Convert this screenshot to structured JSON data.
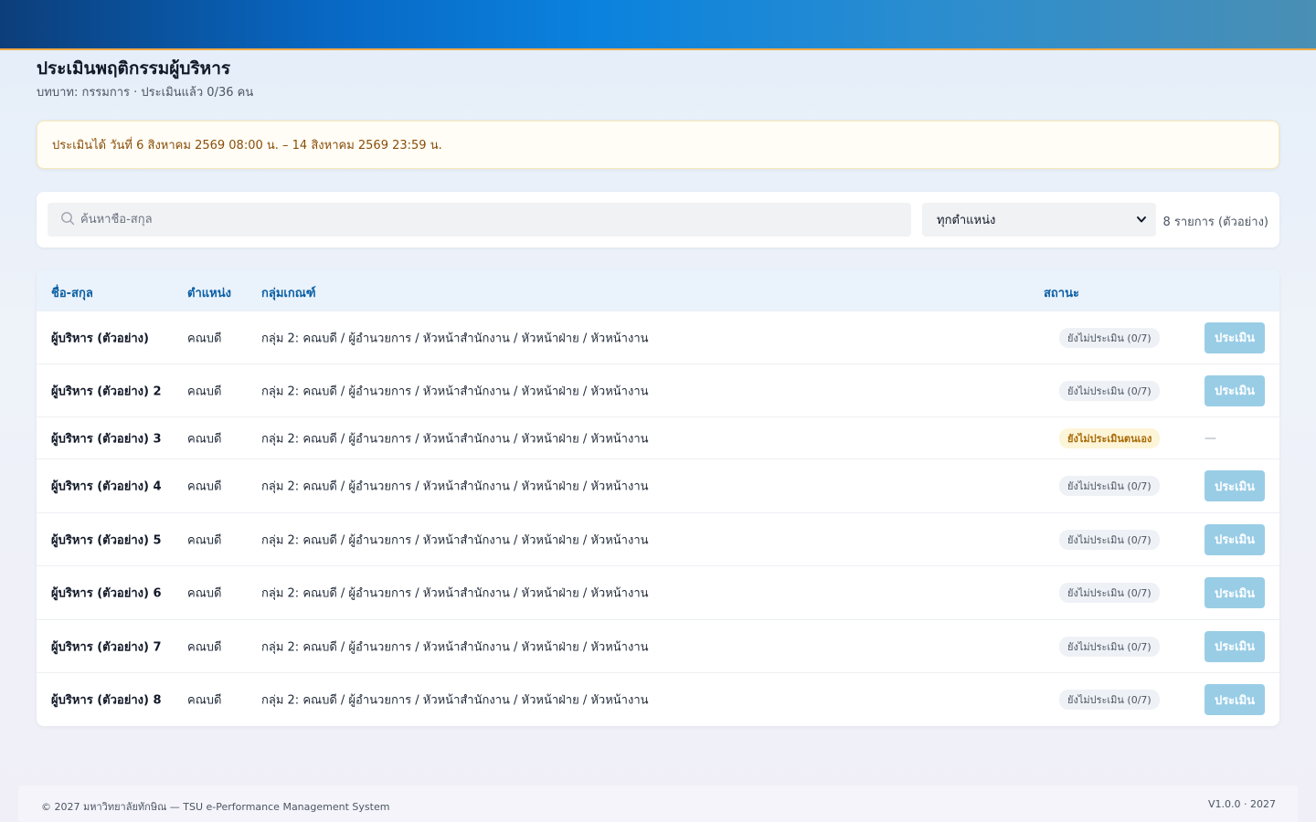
{
  "header": {
    "title": "ประเมินพฤติกรรมผู้บริหาร",
    "subtitle": "บทบาท: กรรมการ · ประเมินแล้ว 0/36 คน"
  },
  "notice": "ประเมินได้ วันที่ 6 สิงหาคม 2569 08:00 น. – 14 สิงหาคม 2569 23:59 น.",
  "filters": {
    "search_placeholder": "ค้นหาชื่อ-สกุล",
    "position_selected": "ทุกตำแหน่ง",
    "count_label": "8 รายการ (ตัวอย่าง)"
  },
  "table": {
    "headers": {
      "name": "ชื่อ-สกุล",
      "position": "ตำแหน่ง",
      "group": "กลุ่มเกณฑ์",
      "status": "สถานะ"
    },
    "action_label": "ประเมิน",
    "rows": [
      {
        "name": "ผู้บริหาร (ตัวอย่าง)",
        "position": "คณบดี",
        "group": "กลุ่ม 2: คณบดี / ผู้อำนวยการ / หัวหน้าสำนักงาน / หัวหน้าฝ่าย / หัวหน้างาน",
        "status": "ยังไม่ประเมิน (0/7)",
        "action": "ประเมิน"
      },
      {
        "name": "ผู้บริหาร (ตัวอย่าง) 2",
        "position": "คณบดี",
        "group": "กลุ่ม 2: คณบดี / ผู้อำนวยการ / หัวหน้าสำนักงาน / หัวหน้าฝ่าย / หัวหน้างาน",
        "status": "ยังไม่ประเมิน (0/7)",
        "action": "ประเมิน"
      },
      {
        "name": "ผู้บริหาร (ตัวอย่าง) 3",
        "position": "คณบดี",
        "group": "กลุ่ม 2: คณบดี / ผู้อำนวยการ / หัวหน้าสำนักงาน / หัวหน้าฝ่าย / หัวหน้างาน",
        "status": "ยังไม่ประเมินตนเอง",
        "action": "—"
      },
      {
        "name": "ผู้บริหาร (ตัวอย่าง) 4",
        "position": "คณบดี",
        "group": "กลุ่ม 2: คณบดี / ผู้อำนวยการ / หัวหน้าสำนักงาน / หัวหน้าฝ่าย / หัวหน้างาน",
        "status": "ยังไม่ประเมิน (0/7)",
        "action": "ประเมิน"
      },
      {
        "name": "ผู้บริหาร (ตัวอย่าง) 5",
        "position": "คณบดี",
        "group": "กลุ่ม 2: คณบดี / ผู้อำนวยการ / หัวหน้าสำนักงาน / หัวหน้าฝ่าย / หัวหน้างาน",
        "status": "ยังไม่ประเมิน (0/7)",
        "action": "ประเมิน"
      },
      {
        "name": "ผู้บริหาร (ตัวอย่าง) 6",
        "position": "คณบดี",
        "group": "กลุ่ม 2: คณบดี / ผู้อำนวยการ / หัวหน้าสำนักงาน / หัวหน้าฝ่าย / หัวหน้างาน",
        "status": "ยังไม่ประเมิน (0/7)",
        "action": "ประเมิน"
      },
      {
        "name": "ผู้บริหาร (ตัวอย่าง) 7",
        "position": "คณบดี",
        "group": "กลุ่ม 2: คณบดี / ผู้อำนวยการ / หัวหน้าสำนักงาน / หัวหน้าฝ่าย / หัวหน้างาน",
        "status": "ยังไม่ประเมิน (0/7)",
        "action": "ประเมิน"
      },
      {
        "name": "ผู้บริหาร (ตัวอย่าง) 8",
        "position": "คณบดี",
        "group": "กลุ่ม 2: คณบดี / ผู้อำนวยการ / หัวหน้าสำนักงาน / หัวหน้าฝ่าย / หัวหน้างาน",
        "status": "ยังไม่ประเมิน (0/7)",
        "action": "ประเมิน"
      }
    ]
  },
  "footer": {
    "copyright": "© 2027 มหาวิทยาลัยทักษิณ — TSU e-Performance Management System",
    "version": "V1.0.0 · 2027"
  },
  "colors": {
    "accent": "#0a82de",
    "header_text": "#0a5fa4",
    "notice_text": "#8a4d08",
    "button_disabled": "#99cde6"
  }
}
